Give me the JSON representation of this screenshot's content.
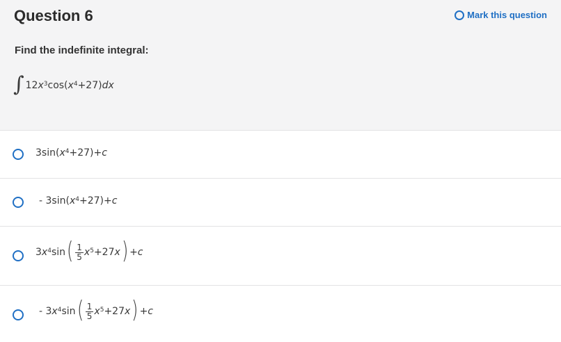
{
  "question": {
    "title": "Question 6",
    "mark_label": "Mark this question",
    "prompt": "Find the indefinite integral:"
  },
  "integral": {
    "coef": "12",
    "var": "x",
    "pow": "3",
    "func": "cos(",
    "inner_var": "x",
    "inner_pow": "4",
    "inner_rest": "+27)",
    "d": "dx"
  },
  "options": [
    {
      "pre": "3sin(",
      "var": "x",
      "pow": "4",
      "rest": "+27)+",
      "c": "c"
    },
    {
      "pre": "- 3sin(",
      "var": "x",
      "pow": "4",
      "rest": "+27)+",
      "c": "c"
    },
    {
      "pre": "3",
      "var": "x",
      "pow": "4",
      "func": "sin",
      "num": "1",
      "den": "5",
      "ivar": "x",
      "ipow": "5",
      "irest": "+27",
      "ivar2": "x",
      "tail": "+",
      "c": "c"
    },
    {
      "pre": "- 3",
      "var": "x",
      "pow": "4",
      "func": "sin",
      "num": "1",
      "den": "5",
      "ivar": "x",
      "ipow": "5",
      "irest": "+27",
      "ivar2": "x",
      "tail": "+",
      "c": "c"
    }
  ],
  "colors": {
    "accent": "#1f6fc4",
    "header_bg": "#f4f4f5"
  }
}
